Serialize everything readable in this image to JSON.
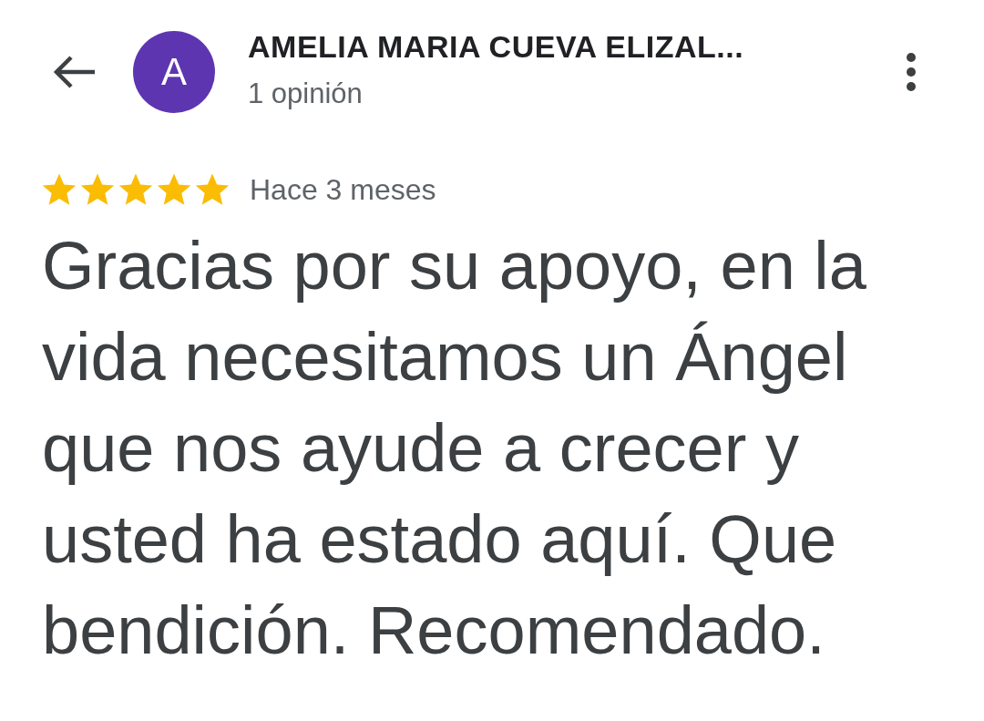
{
  "header": {
    "avatar_letter": "A",
    "author": "AMELIA MARIA CUEVA ELIZAL...",
    "review_count": "1 opinión"
  },
  "review": {
    "stars": 5,
    "time": "Hace 3 meses",
    "text": "Gracias por su apoyo, en la vida necesitamos un Ángel que nos ayude a crecer y usted ha estado aquí. Que bendición. Recomendado."
  }
}
